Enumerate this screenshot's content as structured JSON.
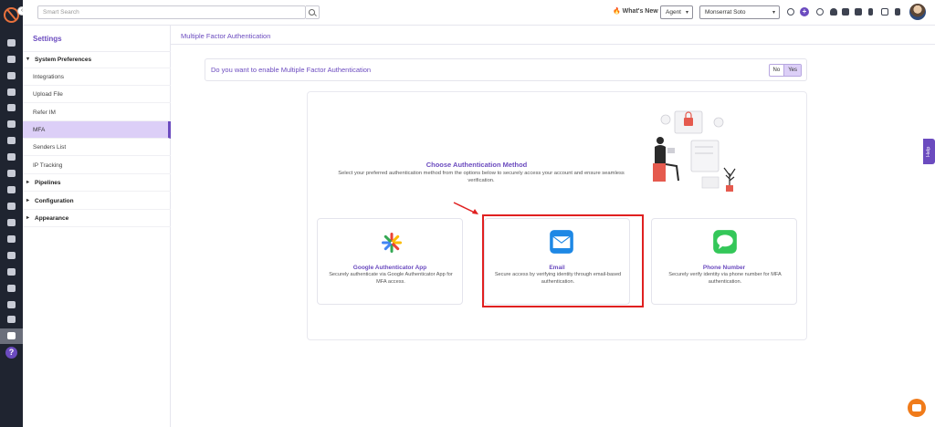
{
  "topbar": {
    "search_placeholder": "Smart Search",
    "whats_new": "What's New",
    "role_select": "Agent",
    "user_select": "Monserrat Soto"
  },
  "sidebar": {
    "title": "Settings",
    "items": [
      {
        "label": "System Preferences",
        "type": "group-open"
      },
      {
        "label": "Integrations"
      },
      {
        "label": "Upload File"
      },
      {
        "label": "Refer IM"
      },
      {
        "label": "MFA",
        "active": true
      },
      {
        "label": "Senders List"
      },
      {
        "label": "IP Tracking"
      },
      {
        "label": "Pipelines",
        "type": "group"
      },
      {
        "label": "Configuration",
        "type": "group"
      },
      {
        "label": "Appearance",
        "type": "group"
      }
    ]
  },
  "main": {
    "breadcrumb": "Multiple Factor Authentication",
    "question": "Do you want to enable Multiple Factor Authentication",
    "toggle_no": "No",
    "toggle_yes": "Yes",
    "choose_title": "Choose Authentication Method",
    "choose_subtitle": "Select your preferred authentication method from the options below to securely access your account and ensure seamless verification.",
    "methods": [
      {
        "name": "Google Authenticator App",
        "desc": "Securely authenticate via Google Authenticator App for MFA access.",
        "icon": "google-authenticator-icon"
      },
      {
        "name": "Email",
        "desc": "Secure access by verifying identity through email-based authentication.",
        "icon": "email-icon",
        "highlighted": true
      },
      {
        "name": "Phone Number",
        "desc": "Securely verify identity via phone number for MFA authentication.",
        "icon": "message-icon"
      }
    ]
  },
  "help_tab": "Help",
  "colors": {
    "accent": "#6b4bbf",
    "highlight": "#e02020",
    "rail": "#1f2430",
    "chat": "#f07b1a"
  }
}
